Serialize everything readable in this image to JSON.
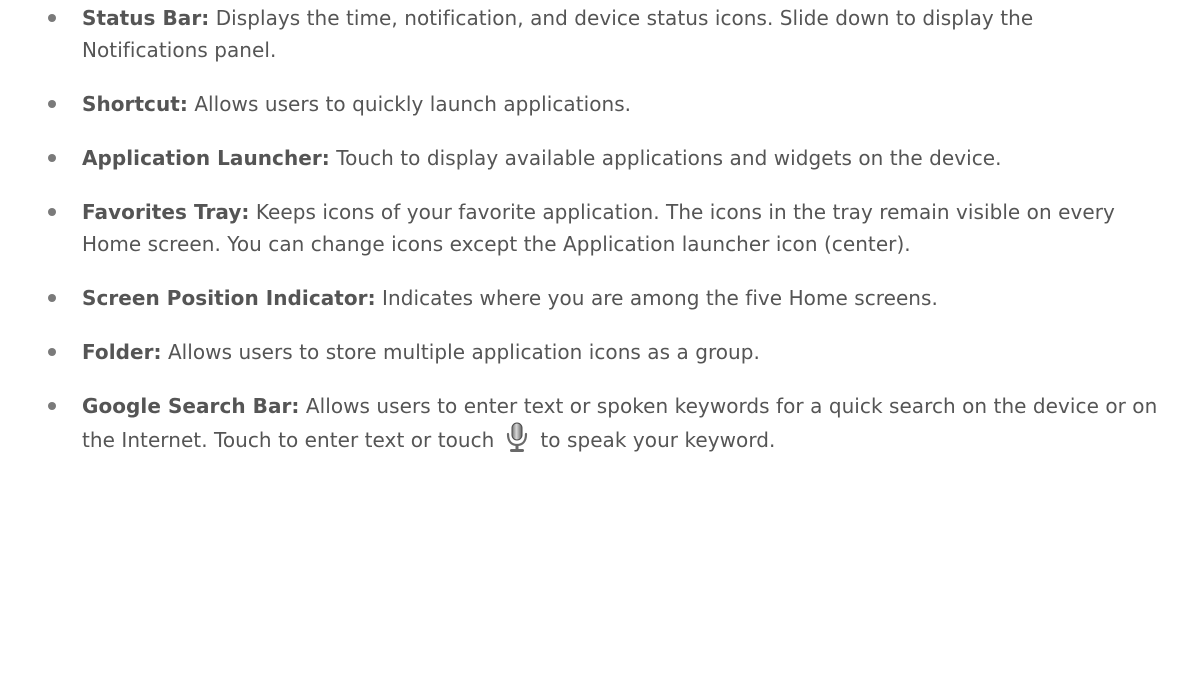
{
  "items": [
    {
      "term": "Status Bar:",
      "text": " Displays the time, notification, and device status icons. Slide down to display the Notifications panel."
    },
    {
      "term": "Shortcut:",
      "text": " Allows users to quickly launch applications."
    },
    {
      "term": "Application Launcher:",
      "text": " Touch to display available applications and widgets on the device."
    },
    {
      "term": "Favorites Tray:",
      "text": " Keeps icons of your favorite application. The icons in the tray remain visible on every Home screen. You can change icons except the Application launcher icon (center)."
    },
    {
      "term": "Screen Position Indicator:",
      "text": " Indicates where you are among the five Home screens."
    },
    {
      "term": "Folder:",
      "text": " Allows users to store multiple application icons as a group."
    },
    {
      "term": "Google Search Bar:",
      "text_before_icon": " Allows users to enter text or spoken keywords for a quick search on the device or on the Internet. Touch to enter text or touch",
      "icon": "microphone-icon",
      "text_after_icon": "to speak your keyword."
    }
  ],
  "colors": {
    "text": "#555555",
    "bullet": "#7a7a7a"
  }
}
